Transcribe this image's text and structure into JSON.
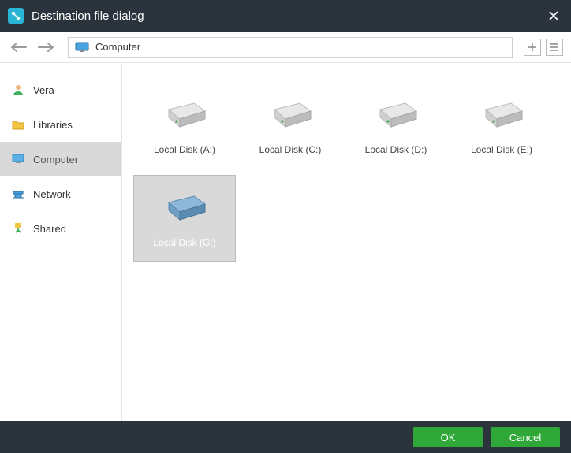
{
  "window": {
    "title": "Destination file dialog"
  },
  "path": {
    "label": "Computer"
  },
  "sidebar": {
    "items": [
      {
        "label": "Vera"
      },
      {
        "label": "Libraries"
      },
      {
        "label": "Computer"
      },
      {
        "label": "Network"
      },
      {
        "label": "Shared"
      }
    ],
    "activeIndex": 2
  },
  "drives": [
    {
      "label": "Local Disk (A:)",
      "selected": false,
      "kind": "gray"
    },
    {
      "label": "Local Disk (C:)",
      "selected": false,
      "kind": "gray"
    },
    {
      "label": "Local Disk (D:)",
      "selected": false,
      "kind": "gray"
    },
    {
      "label": "Local Disk (E:)",
      "selected": false,
      "kind": "gray"
    },
    {
      "label": "Local Disk (G:)",
      "selected": true,
      "kind": "blue"
    }
  ],
  "footer": {
    "ok": "OK",
    "cancel": "Cancel"
  },
  "icons": {
    "back": "back-icon",
    "forward": "forward-icon",
    "newfolder": "new-folder-icon",
    "viewmode": "view-mode-icon",
    "close": "close-icon",
    "location": "monitor-icon"
  }
}
